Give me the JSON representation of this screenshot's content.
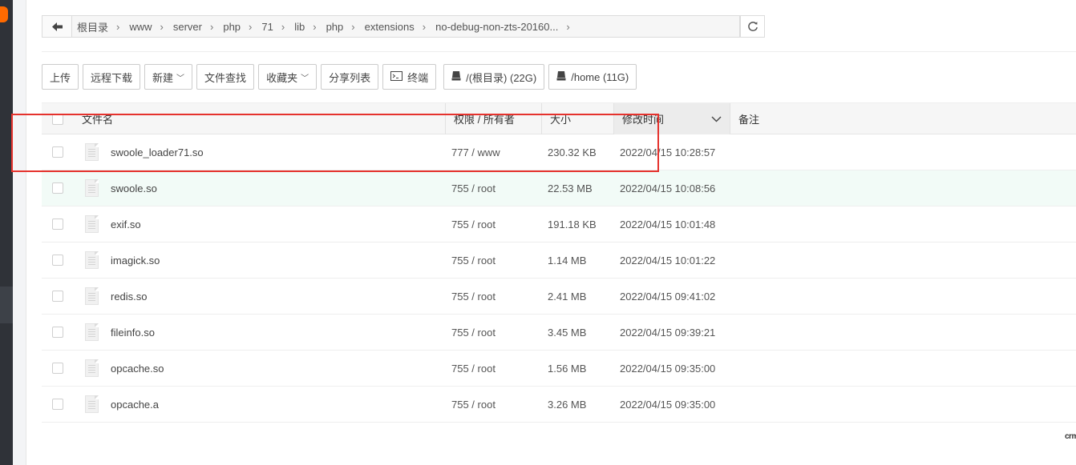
{
  "colors": {
    "accent": "#20a53a",
    "highlight_row": "#f2fbf7",
    "annotation": "#e5322d"
  },
  "pathbar": {
    "back_icon": "arrow-left-icon",
    "crumbs": [
      "根目录",
      "www",
      "server",
      "php",
      "71",
      "lib",
      "php",
      "extensions",
      "no-debug-non-zts-20160..."
    ],
    "refresh_icon": "refresh-icon"
  },
  "toolbar": {
    "upload": "上传",
    "remote_download": "远程下载",
    "new": "新建",
    "file_search": "文件查找",
    "favorites": "收藏夹",
    "share_list": "分享列表",
    "terminal": "终端",
    "disk_root": "/(根目录) (22G)",
    "disk_home": "/home (11G)"
  },
  "table": {
    "headers": {
      "name": "文件名",
      "perm": "权限 / 所有者",
      "size": "大小",
      "mtime": "修改时间",
      "note": "备注"
    },
    "rows": [
      {
        "name": "swoole_loader71.so",
        "perm": "777 / www",
        "size": "230.32 KB",
        "mtime": "2022/04/15 10:28:57"
      },
      {
        "name": "swoole.so",
        "perm": "755 / root",
        "size": "22.53 MB",
        "mtime": "2022/04/15 10:08:56"
      },
      {
        "name": "exif.so",
        "perm": "755 / root",
        "size": "191.18 KB",
        "mtime": "2022/04/15 10:01:48"
      },
      {
        "name": "imagick.so",
        "perm": "755 / root",
        "size": "1.14 MB",
        "mtime": "2022/04/15 10:01:22"
      },
      {
        "name": "redis.so",
        "perm": "755 / root",
        "size": "2.41 MB",
        "mtime": "2022/04/15 09:41:02"
      },
      {
        "name": "fileinfo.so",
        "perm": "755 / root",
        "size": "3.45 MB",
        "mtime": "2022/04/15 09:39:21"
      },
      {
        "name": "opcache.so",
        "perm": "755 / root",
        "size": "1.56 MB",
        "mtime": "2022/04/15 09:35:00"
      },
      {
        "name": "opcache.a",
        "perm": "755 / root",
        "size": "3.26 MB",
        "mtime": "2022/04/15 09:35:00"
      }
    ]
  },
  "watermark": "crmeb"
}
